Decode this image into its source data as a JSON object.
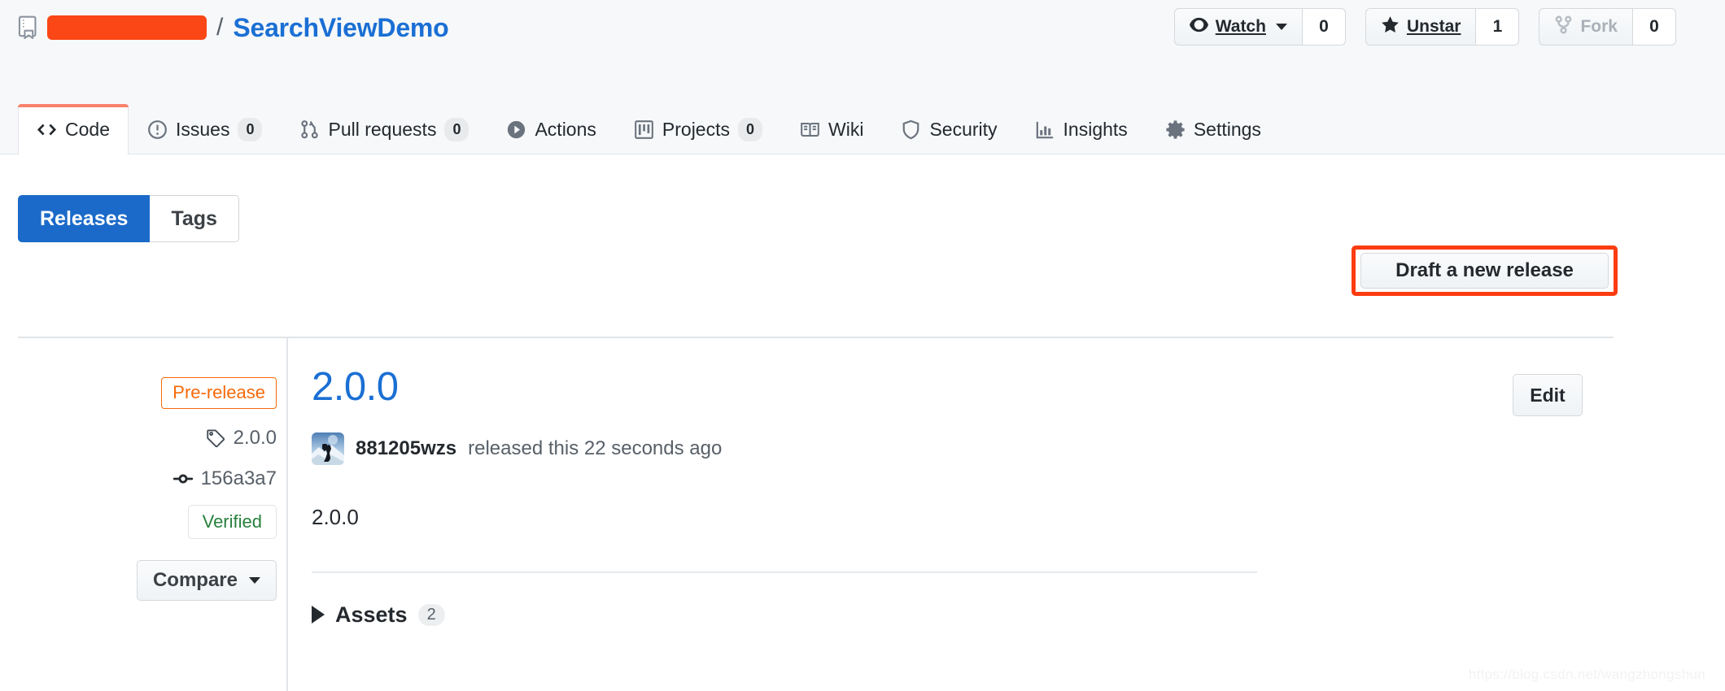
{
  "header": {
    "repo_icon": "repo-book-icon",
    "owner_redacted": true,
    "owner_redaction_color": "#fb4616",
    "separator": "/",
    "repo_name": "SearchViewDemo",
    "social": [
      {
        "id": "watch",
        "icon": "eye-icon",
        "label": "Watch",
        "count": "0",
        "has_caret": true,
        "disabled": false
      },
      {
        "id": "unstar",
        "icon": "star-icon",
        "label": "Unstar",
        "count": "1",
        "has_caret": false,
        "disabled": false
      },
      {
        "id": "fork",
        "icon": "fork-icon",
        "label": "Fork",
        "count": "0",
        "has_caret": false,
        "disabled": true
      }
    ]
  },
  "nav": {
    "tabs": [
      {
        "id": "code",
        "icon": "code-icon",
        "label": "Code",
        "count": null,
        "active": true
      },
      {
        "id": "issues",
        "icon": "issue-icon",
        "label": "Issues",
        "count": "0",
        "active": false
      },
      {
        "id": "pull-requests",
        "icon": "git-pull-icon",
        "label": "Pull requests",
        "count": "0",
        "active": false
      },
      {
        "id": "actions",
        "icon": "play-icon",
        "label": "Actions",
        "count": null,
        "active": false
      },
      {
        "id": "projects",
        "icon": "project-icon",
        "label": "Projects",
        "count": "0",
        "active": false
      },
      {
        "id": "wiki",
        "icon": "book-icon",
        "label": "Wiki",
        "count": null,
        "active": false
      },
      {
        "id": "security",
        "icon": "shield-icon",
        "label": "Security",
        "count": null,
        "active": false
      },
      {
        "id": "insights",
        "icon": "graph-icon",
        "label": "Insights",
        "count": null,
        "active": false
      },
      {
        "id": "settings",
        "icon": "gear-icon",
        "label": "Settings",
        "count": null,
        "active": false
      }
    ]
  },
  "toolbar": {
    "segments": [
      {
        "id": "releases",
        "label": "Releases",
        "selected": true
      },
      {
        "id": "tags",
        "label": "Tags",
        "selected": false
      }
    ],
    "draft_label": "Draft a new release",
    "draft_highlight_color": "#fc3c11"
  },
  "release": {
    "meta": {
      "pre_release_label": "Pre-release",
      "pre_release_color": "#f66a0a",
      "tag_icon": "tag-icon",
      "tag_name": "2.0.0",
      "commit_icon": "commit-icon",
      "commit_sha": "156a3a7",
      "verified_label": "Verified",
      "verified_color": "#28803d",
      "compare_label": "Compare"
    },
    "title": "2.0.0",
    "edit_label": "Edit",
    "author_avatar": "hiker-avatar",
    "author": "881205wzs",
    "released_text": "released this 22 seconds ago",
    "body": "2.0.0",
    "assets": {
      "label": "Assets",
      "count": "2",
      "expanded": false
    }
  },
  "watermark": "https://blog.csdn.net/wangzhongshun"
}
